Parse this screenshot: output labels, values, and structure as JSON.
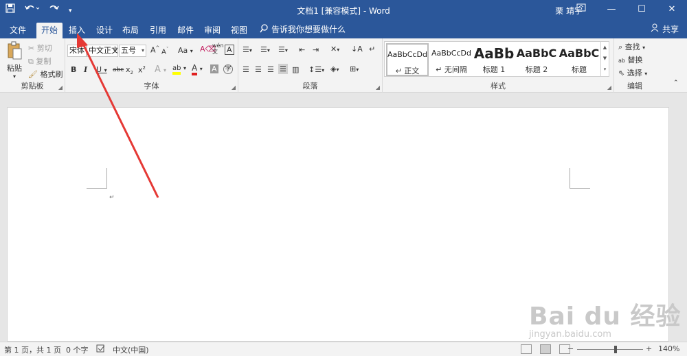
{
  "titlebar": {
    "doc_title": "文档1 [兼容模式] - Word",
    "user": "栗 靖宇",
    "save_icon": "save-icon",
    "undo_icon": "undo-icon",
    "redo_icon": "redo-icon"
  },
  "tabs": [
    "文件",
    "开始",
    "插入",
    "设计",
    "布局",
    "引用",
    "邮件",
    "审阅",
    "视图"
  ],
  "active_tab": "开始",
  "tell_me": "告诉我你想要做什么",
  "share": "共享",
  "clipboard": {
    "paste": "粘贴",
    "cut": "剪切",
    "copy": "复制",
    "format_painter": "格式刷",
    "label": "剪贴板"
  },
  "font": {
    "font_east": "宋体",
    "font_west": "中文正文",
    "size": "五号",
    "label": "字体",
    "wen": "wén"
  },
  "paragraph": {
    "label": "段落"
  },
  "styles": {
    "label": "样式",
    "items": [
      {
        "sample": "AaBbCcDd",
        "name": "↵ 正文"
      },
      {
        "sample": "AaBbCcDd",
        "name": "↵ 无间隔"
      },
      {
        "sample": "AaBb",
        "name": "标题 1"
      },
      {
        "sample": "AaBbC",
        "name": "标题 2"
      },
      {
        "sample": "AaBbC",
        "name": "标题"
      }
    ]
  },
  "editing": {
    "label": "编辑",
    "find": "查找",
    "replace": "替换",
    "select": "选择"
  },
  "document": {
    "para_mark": "↵"
  },
  "statusbar": {
    "page": "第 1 页，共 1 页",
    "words": "0 个字",
    "language": "中文(中国)",
    "zoom": "140%"
  },
  "watermark": {
    "logo": "Bai du 经验",
    "url": "jingyan.baidu.com"
  },
  "colors": {
    "brand_blue": "#2b579a",
    "ribbon_bg": "#f3f3f3",
    "arrow_red": "#e53935",
    "font_color_underline": "#e02020",
    "highlight_yellow": "#ffff00"
  }
}
